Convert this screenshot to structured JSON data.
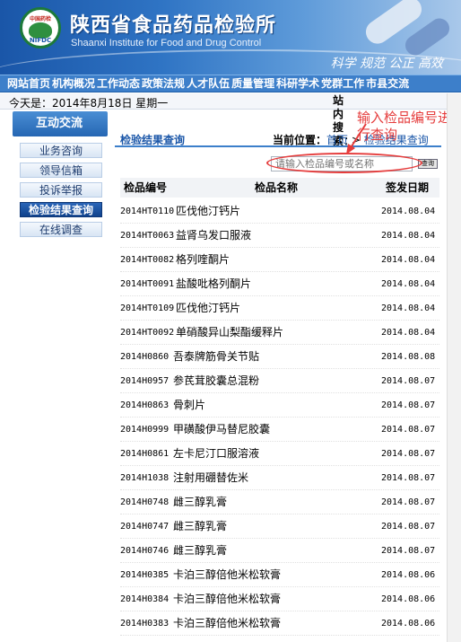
{
  "header": {
    "logo_text": "中国药检",
    "logo_sub": "NIFDC",
    "title_cn": "陕西省食品药品检验所",
    "title_en": "Shaanxi Institute for Food and Drug Control",
    "slogan": "科学  规范  公正  高效"
  },
  "nav": [
    "网站首页",
    "机构概况",
    "工作动态",
    "政策法规",
    "人才队伍",
    "质量管理",
    "科研学术",
    "党群工作",
    "市县交流"
  ],
  "dateline": {
    "date": "今天是：2014年8月18日  星期一",
    "search_label": "站内搜索："
  },
  "sidebar": {
    "heading": "互动交流",
    "items": [
      "业务咨询",
      "领导信箱",
      "投诉举报",
      "检验结果查询",
      "在线调查"
    ]
  },
  "main": {
    "section_title": "检验结果查询",
    "breadcrumb_label": "当前位置：",
    "breadcrumb_home": "首页",
    "breadcrumb_sep": " > ",
    "breadcrumb_current": "检验结果查询",
    "search_placeholder": "请输入检品编号或名称",
    "search_button": "查询",
    "columns": {
      "code": "检品编号",
      "name": "检品名称",
      "date": "签发日期"
    },
    "rows": [
      {
        "code": "2014HT0110",
        "name": "匹伐他汀钙片",
        "date": "2014.08.04"
      },
      {
        "code": "2014HT0063",
        "name": "益肾乌发口服液",
        "date": "2014.08.04"
      },
      {
        "code": "2014HT0082",
        "name": "格列喹酮片",
        "date": "2014.08.04"
      },
      {
        "code": "2014HT0091",
        "name": "盐酸吡格列酮片",
        "date": "2014.08.04"
      },
      {
        "code": "2014HT0109",
        "name": "匹伐他汀钙片",
        "date": "2014.08.04"
      },
      {
        "code": "2014HT0092",
        "name": "单硝酸异山梨酯缓释片",
        "date": "2014.08.04"
      },
      {
        "code": "2014H0860",
        "name": "吾泰牌筋骨关节贴",
        "date": "2014.08.08"
      },
      {
        "code": "2014H0957",
        "name": "参芪茸胶囊总混粉",
        "date": "2014.08.07"
      },
      {
        "code": "2014H0863",
        "name": "骨刺片",
        "date": "2014.08.07"
      },
      {
        "code": "2014H0999",
        "name": "甲磺酸伊马替尼胶囊",
        "date": "2014.08.07"
      },
      {
        "code": "2014H0861",
        "name": "左卡尼汀口服溶液",
        "date": "2014.08.07"
      },
      {
        "code": "2014H1038",
        "name": "注射用硼替佐米",
        "date": "2014.08.07"
      },
      {
        "code": "2014H0748",
        "name": "雌三醇乳膏",
        "date": "2014.08.07"
      },
      {
        "code": "2014H0747",
        "name": "雌三醇乳膏",
        "date": "2014.08.07"
      },
      {
        "code": "2014H0746",
        "name": "雌三醇乳膏",
        "date": "2014.08.07"
      },
      {
        "code": "2014H0385",
        "name": "卡泊三醇倍他米松软膏",
        "date": "2014.08.06"
      },
      {
        "code": "2014H0384",
        "name": "卡泊三醇倍他米松软膏",
        "date": "2014.08.06"
      },
      {
        "code": "2014H0383",
        "name": "卡泊三醇倍他米松软膏",
        "date": "2014.08.06"
      }
    ]
  },
  "annotation": {
    "text": "输入检品编号进行查询",
    "color": "#e53c3c"
  },
  "colors": {
    "brand_blue": "#1a56a8",
    "nav_blue": "#3d7fca",
    "annotation_red": "#e53c3c"
  }
}
